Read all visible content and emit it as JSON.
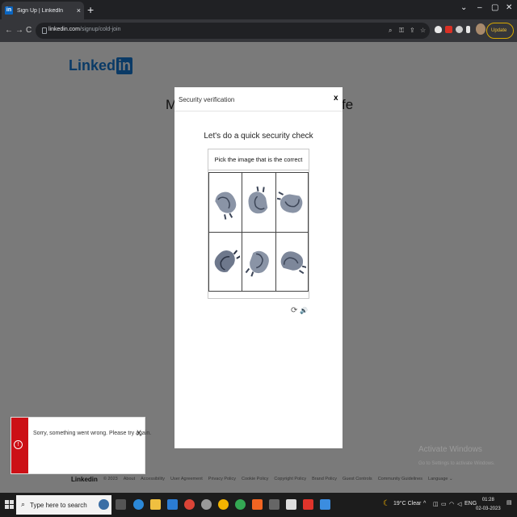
{
  "browser": {
    "tab_title": "Sign Up | LinkedIn",
    "tab_favicon": "in",
    "new_tab": "+",
    "url_host": "linkedin.com",
    "url_path": "/signup/cold-join",
    "update_label": "Update",
    "window_controls": [
      "⌄",
      "–",
      "▢",
      "✕"
    ]
  },
  "page": {
    "logo_text": "Linked",
    "logo_in": "in",
    "headline_left": "M",
    "headline_right": "fe"
  },
  "modal": {
    "title": "Security verification",
    "close": "x",
    "check_title": "Let's do a quick security check",
    "instruction": "Pick the image that is the correct way up",
    "reload_icon": "⟳",
    "audio_icon": "🔊"
  },
  "toast": {
    "message": "Sorry, something went wrong. Please try again.",
    "close": "X",
    "icon": "!"
  },
  "footer": {
    "logo": "Linkedin",
    "links": [
      "© 2023",
      "About",
      "Accessibility",
      "User Agreement",
      "Privacy Policy",
      "Cookie Policy",
      "Copyright Policy",
      "Brand Policy",
      "Guest Controls",
      "Community Guidelines",
      "Language"
    ]
  },
  "watermark": {
    "line1": "Activate Windows",
    "line2": "Go to Settings to activate Windows."
  },
  "taskbar": {
    "search_placeholder": "Type here to search",
    "weather": "19°C  Clear",
    "lang": "ENG",
    "time": "01:28",
    "date": "02-03-2023"
  },
  "colors": {
    "linkedin_blue": "#0a66c2",
    "error_red": "#cc1016"
  }
}
